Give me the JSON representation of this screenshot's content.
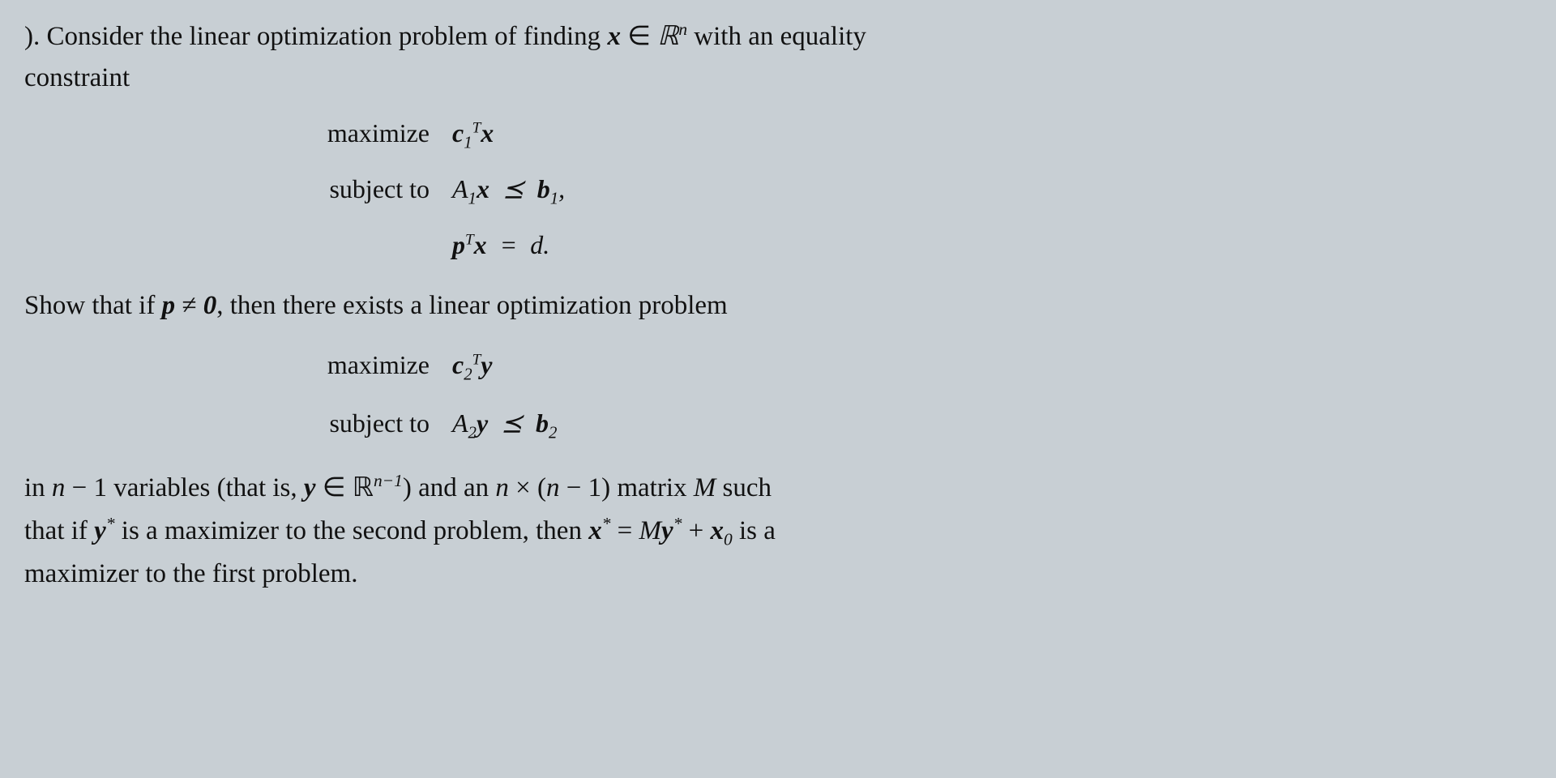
{
  "page": {
    "background_color": "#c8cfd4",
    "problem_prefix": ").",
    "intro_text": "Consider the linear optimization problem of finding",
    "x_in_Rn": "x ∈ ℝⁿ with an equality constraint",
    "first_problem": {
      "maximize_label": "maximize",
      "maximize_expr": "c₁ᵀx",
      "subject_to_label": "subject to",
      "constraint1": "A₁x ≼ b₁,",
      "constraint2": "pᵀx = d."
    },
    "show_statement": "Show that if p ≠ 0, then there exists a linear optimization problem",
    "second_problem": {
      "maximize_label": "maximize",
      "maximize_expr": "c₂ᵀy",
      "subject_to_label": "subject to",
      "constraint1": "A₂y ≼ b₂"
    },
    "conclusion": "in n − 1 variables (that is, y ∈ ℝⁿ⁻¹) and an n × (n − 1) matrix M such that if y* is a maximizer to the second problem, then x* = My* + x₀ is a maximizer to the first problem.",
    "truncated_bottom": "..."
  }
}
